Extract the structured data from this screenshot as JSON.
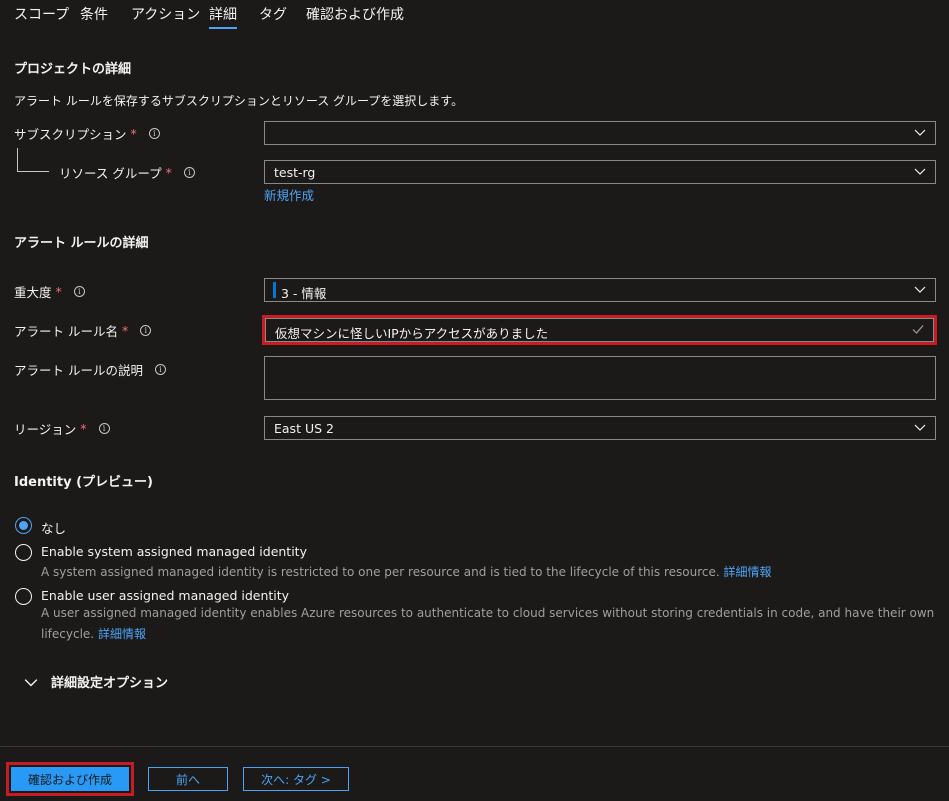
{
  "tabs": [
    {
      "label": "スコープ"
    },
    {
      "label": "条件"
    },
    {
      "label": "アクション"
    },
    {
      "label": "詳細",
      "active": true
    },
    {
      "label": "タグ"
    },
    {
      "label": "確認および作成"
    }
  ],
  "project": {
    "title": "プロジェクトの詳細",
    "description": "アラート ルールを保存するサブスクリプションとリソース グループを選択します。",
    "subscription_label": "サブスクリプション",
    "subscription_value": "",
    "resource_group_label": "リソース グループ",
    "resource_group_value": "test-rg",
    "create_new": "新規作成"
  },
  "alert_rule": {
    "title": "アラート ルールの詳細",
    "severity_label": "重大度",
    "severity_value": "3 - 情報",
    "severity_color": "#0078d4",
    "name_label": "アラート ルール名",
    "name_value": "仮想マシンに怪しいIPからアクセスがありました",
    "description_label": "アラート ルールの説明",
    "description_value": "",
    "region_label": "リージョン",
    "region_value": "East US 2"
  },
  "identity": {
    "title": "Identity (プレビュー)",
    "options": [
      {
        "label": "なし",
        "checked": true
      },
      {
        "label": "Enable system assigned managed identity",
        "description": "A system assigned managed identity is restricted to one per resource and is tied to the lifecycle of this resource.",
        "link": "詳細情報"
      },
      {
        "label": "Enable user assigned managed identity",
        "description_line1": "A user assigned managed identity enables Azure resources to authenticate to cloud services without storing credentials in code, and have their own",
        "description_line2": "lifecycle.",
        "link": "詳細情報"
      }
    ]
  },
  "advanced": {
    "label": "詳細設定オプション"
  },
  "footer": {
    "review_create": "確認および作成",
    "previous": "前へ",
    "next": "次へ: タグ >"
  },
  "colors": {
    "accent": "#4da3f5",
    "highlight": "#c81c25",
    "background": "#1b1a19"
  }
}
